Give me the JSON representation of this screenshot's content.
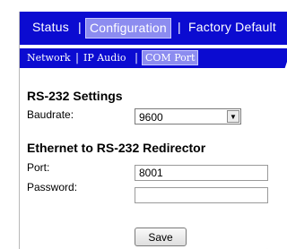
{
  "top_nav": {
    "items": [
      {
        "label": "Status"
      },
      {
        "label": "Configuration",
        "active": true
      },
      {
        "label": "Factory Default"
      }
    ],
    "separator": "|"
  },
  "sub_nav": {
    "items": [
      {
        "label": "Network"
      },
      {
        "label": "IP Audio"
      },
      {
        "label": "COM Port",
        "active": true
      }
    ],
    "separator": "|"
  },
  "rs232": {
    "title": "RS-232 Settings",
    "baudrate_label": "Baudrate:",
    "baudrate_value": "9600",
    "dropdown_glyph": "▼"
  },
  "redirector": {
    "title": "Ethernet to RS-232 Redirector",
    "port_label": "Port:",
    "port_value": "8001",
    "password_label": "Password:",
    "password_value": ""
  },
  "actions": {
    "save_label": "Save"
  },
  "colors": {
    "nav_bg": "#0b0bd1",
    "nav_active_bg": "#8c8cf0",
    "nav_text": "#ffffff"
  }
}
